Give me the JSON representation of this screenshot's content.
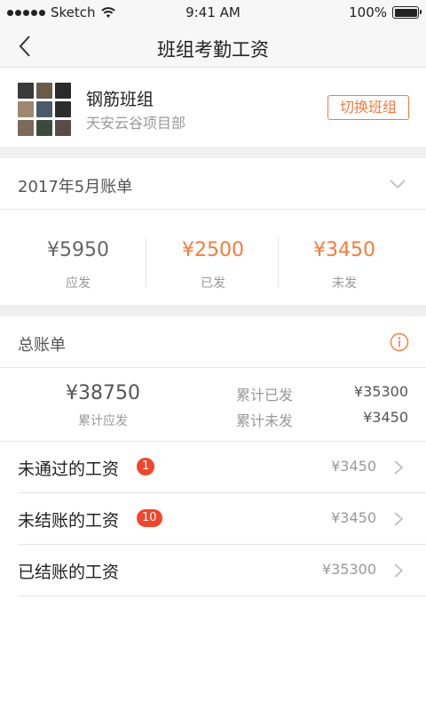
{
  "status_bar": {
    "carrier": "Sketch",
    "time": "9:41 AM",
    "battery": "100%"
  },
  "nav": {
    "title": "班组考勤工资",
    "back_icon": "chevron-left-icon"
  },
  "team": {
    "name": "钢筋班组",
    "project": "天安云谷项目部",
    "switch_label": "切换班组",
    "avatar_colors": [
      "#3a3a3a",
      "#6b5a4a",
      "#2a2a2a",
      "#a08870",
      "#4a5a6a",
      "#2c2c2c",
      "#7a6a5a",
      "#3c4a3c",
      "#5a4a4a"
    ]
  },
  "month_bill": {
    "label": "2017年5月账单",
    "columns": [
      {
        "value": "¥5950",
        "label": "应发",
        "color": "#666666"
      },
      {
        "value": "¥2500",
        "label": "已发",
        "color": "#f47c3c"
      },
      {
        "value": "¥3450",
        "label": "未发",
        "color": "#f47c3c"
      }
    ]
  },
  "total_bill": {
    "label": "总账单",
    "total_value": "¥38750",
    "total_label": "累计应发",
    "paid_label": "累计已发",
    "paid_value": "¥35300",
    "unpaid_label": "累计未发",
    "unpaid_value": "¥3450"
  },
  "rows": [
    {
      "title": "未通过的工资",
      "badge": "1",
      "amount": "¥3450"
    },
    {
      "title": "未结账的工资",
      "badge": "10",
      "amount": "¥3450"
    },
    {
      "title": "已结账的工资",
      "badge": "",
      "amount": "¥35300"
    }
  ],
  "colors": {
    "accent": "#f47c3c",
    "badge": "#f0462c"
  }
}
